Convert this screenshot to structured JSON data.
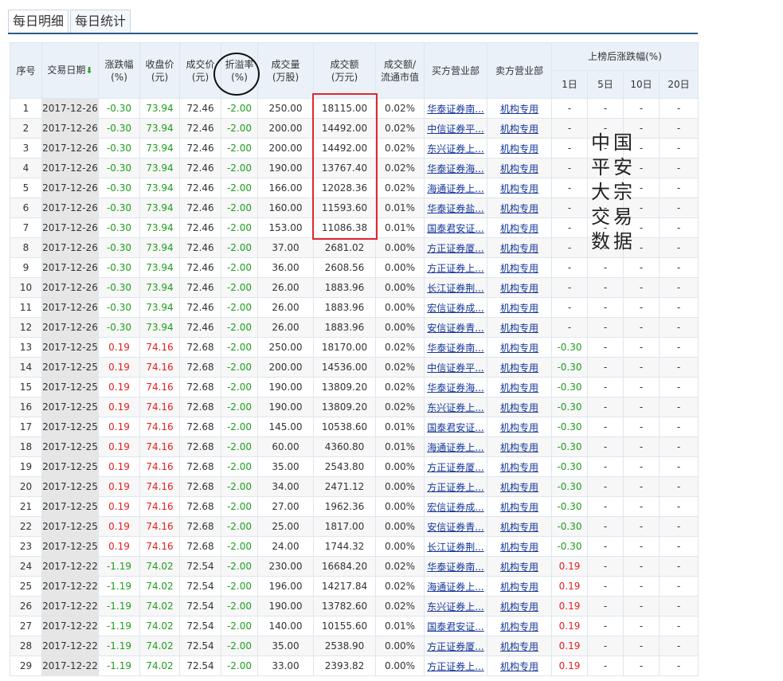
{
  "tabs": [
    "每日明细",
    "每日统计"
  ],
  "header": {
    "seq": "序号",
    "date": "交易日期",
    "date_sort_icon": "arrow-down-icon",
    "change_line1": "涨跌幅",
    "change_line2": "(%)",
    "close_line1": "收盘价",
    "close_line2": "(元)",
    "price_line1": "成交价",
    "price_line2": "(元)",
    "discount_line1": "折溢率",
    "discount_line2": "(%)",
    "volume_line1": "成交量",
    "volume_line2": "(万股)",
    "amount_line1": "成交额",
    "amount_line2": "(万元)",
    "ratio_line1": "成交额/",
    "ratio_line2": "流通市值",
    "buyer": "买方营业部",
    "seller": "卖方营业部",
    "after_group": "上榜后涨跌幅(%)",
    "d1": "1日",
    "d5": "5日",
    "d10": "10日",
    "d20": "20日"
  },
  "rows": [
    [
      "1",
      "2017-12-26",
      "-0.30",
      "73.94",
      "72.46",
      "-2.00",
      "250.00",
      "18115.00",
      "0.02%",
      "华泰证券南...",
      "机构专用",
      "-",
      "-",
      "-",
      "-"
    ],
    [
      "2",
      "2017-12-26",
      "-0.30",
      "73.94",
      "72.46",
      "-2.00",
      "200.00",
      "14492.00",
      "0.02%",
      "中信证券平...",
      "机构专用",
      "-",
      "-",
      "-",
      "-"
    ],
    [
      "3",
      "2017-12-26",
      "-0.30",
      "73.94",
      "72.46",
      "-2.00",
      "200.00",
      "14492.00",
      "0.02%",
      "东兴证券上...",
      "机构专用",
      "-",
      "-",
      "-",
      "-"
    ],
    [
      "4",
      "2017-12-26",
      "-0.30",
      "73.94",
      "72.46",
      "-2.00",
      "190.00",
      "13767.40",
      "0.02%",
      "华泰证券海...",
      "机构专用",
      "-",
      "-",
      "-",
      "-"
    ],
    [
      "5",
      "2017-12-26",
      "-0.30",
      "73.94",
      "72.46",
      "-2.00",
      "166.00",
      "12028.36",
      "0.02%",
      "海通证券上...",
      "机构专用",
      "-",
      "-",
      "-",
      "-"
    ],
    [
      "6",
      "2017-12-26",
      "-0.30",
      "73.94",
      "72.46",
      "-2.00",
      "160.00",
      "11593.60",
      "0.01%",
      "华泰证券盐...",
      "机构专用",
      "-",
      "-",
      "-",
      "-"
    ],
    [
      "7",
      "2017-12-26",
      "-0.30",
      "73.94",
      "72.46",
      "-2.00",
      "153.00",
      "11086.38",
      "0.01%",
      "国泰君安证...",
      "机构专用",
      "-",
      "-",
      "-",
      "-"
    ],
    [
      "8",
      "2017-12-26",
      "-0.30",
      "73.94",
      "72.46",
      "-2.00",
      "37.00",
      "2681.02",
      "0.00%",
      "方正证券厦...",
      "机构专用",
      "-",
      "-",
      "-",
      "-"
    ],
    [
      "9",
      "2017-12-26",
      "-0.30",
      "73.94",
      "72.46",
      "-2.00",
      "36.00",
      "2608.56",
      "0.00%",
      "方正证券上...",
      "机构专用",
      "-",
      "-",
      "-",
      "-"
    ],
    [
      "10",
      "2017-12-26",
      "-0.30",
      "73.94",
      "72.46",
      "-2.00",
      "26.00",
      "1883.96",
      "0.00%",
      "长江证券荆...",
      "机构专用",
      "-",
      "-",
      "-",
      "-"
    ],
    [
      "11",
      "2017-12-26",
      "-0.30",
      "73.94",
      "72.46",
      "-2.00",
      "26.00",
      "1883.96",
      "0.00%",
      "宏信证券成...",
      "机构专用",
      "-",
      "-",
      "-",
      "-"
    ],
    [
      "12",
      "2017-12-26",
      "-0.30",
      "73.94",
      "72.46",
      "-2.00",
      "26.00",
      "1883.96",
      "0.00%",
      "安信证券青...",
      "机构专用",
      "-",
      "-",
      "-",
      "-"
    ],
    [
      "13",
      "2017-12-25",
      "0.19",
      "74.16",
      "72.68",
      "-2.00",
      "250.00",
      "18170.00",
      "0.02%",
      "华泰证券南...",
      "机构专用",
      "-0.30",
      "-",
      "-",
      "-"
    ],
    [
      "14",
      "2017-12-25",
      "0.19",
      "74.16",
      "72.68",
      "-2.00",
      "200.00",
      "14536.00",
      "0.02%",
      "中信证券平...",
      "机构专用",
      "-0.30",
      "-",
      "-",
      "-"
    ],
    [
      "15",
      "2017-12-25",
      "0.19",
      "74.16",
      "72.68",
      "-2.00",
      "190.00",
      "13809.20",
      "0.02%",
      "华泰证券海...",
      "机构专用",
      "-0.30",
      "-",
      "-",
      "-"
    ],
    [
      "16",
      "2017-12-25",
      "0.19",
      "74.16",
      "72.68",
      "-2.00",
      "190.00",
      "13809.20",
      "0.02%",
      "东兴证券上...",
      "机构专用",
      "-0.30",
      "-",
      "-",
      "-"
    ],
    [
      "17",
      "2017-12-25",
      "0.19",
      "74.16",
      "72.68",
      "-2.00",
      "145.00",
      "10538.60",
      "0.01%",
      "国泰君安证...",
      "机构专用",
      "-0.30",
      "-",
      "-",
      "-"
    ],
    [
      "18",
      "2017-12-25",
      "0.19",
      "74.16",
      "72.68",
      "-2.00",
      "60.00",
      "4360.80",
      "0.01%",
      "海通证券上...",
      "机构专用",
      "-0.30",
      "-",
      "-",
      "-"
    ],
    [
      "19",
      "2017-12-25",
      "0.19",
      "74.16",
      "72.68",
      "-2.00",
      "35.00",
      "2543.80",
      "0.00%",
      "方正证券厦...",
      "机构专用",
      "-0.30",
      "-",
      "-",
      "-"
    ],
    [
      "20",
      "2017-12-25",
      "0.19",
      "74.16",
      "72.68",
      "-2.00",
      "34.00",
      "2471.12",
      "0.00%",
      "方正证券上...",
      "机构专用",
      "-0.30",
      "-",
      "-",
      "-"
    ],
    [
      "21",
      "2017-12-25",
      "0.19",
      "74.16",
      "72.68",
      "-2.00",
      "27.00",
      "1962.36",
      "0.00%",
      "宏信证券成...",
      "机构专用",
      "-0.30",
      "-",
      "-",
      "-"
    ],
    [
      "22",
      "2017-12-25",
      "0.19",
      "74.16",
      "72.68",
      "-2.00",
      "25.00",
      "1817.00",
      "0.00%",
      "安信证券青...",
      "机构专用",
      "-0.30",
      "-",
      "-",
      "-"
    ],
    [
      "23",
      "2017-12-25",
      "0.19",
      "74.16",
      "72.68",
      "-2.00",
      "24.00",
      "1744.32",
      "0.00%",
      "长江证券荆...",
      "机构专用",
      "-0.30",
      "-",
      "-",
      "-"
    ],
    [
      "24",
      "2017-12-22",
      "-1.19",
      "74.02",
      "72.54",
      "-2.00",
      "230.00",
      "16684.20",
      "0.02%",
      "华泰证券南...",
      "机构专用",
      "0.19",
      "-",
      "-",
      "-"
    ],
    [
      "25",
      "2017-12-22",
      "-1.19",
      "74.02",
      "72.54",
      "-2.00",
      "196.00",
      "14217.84",
      "0.02%",
      "海通证券上...",
      "机构专用",
      "0.19",
      "-",
      "-",
      "-"
    ],
    [
      "26",
      "2017-12-22",
      "-1.19",
      "74.02",
      "72.54",
      "-2.00",
      "190.00",
      "13782.60",
      "0.02%",
      "东兴证券上...",
      "机构专用",
      "0.19",
      "-",
      "-",
      "-"
    ],
    [
      "27",
      "2017-12-22",
      "-1.19",
      "74.02",
      "72.54",
      "-2.00",
      "140.00",
      "10155.60",
      "0.01%",
      "国泰君安证...",
      "机构专用",
      "0.19",
      "-",
      "-",
      "-"
    ],
    [
      "28",
      "2017-12-22",
      "-1.19",
      "74.02",
      "72.54",
      "-2.00",
      "35.00",
      "2538.90",
      "0.00%",
      "方正证券厦...",
      "机构专用",
      "0.19",
      "-",
      "-",
      "-"
    ],
    [
      "29",
      "2017-12-22",
      "-1.19",
      "74.02",
      "72.54",
      "-2.00",
      "33.00",
      "2393.82",
      "0.00%",
      "方正证券上...",
      "机构专用",
      "0.19",
      "-",
      "-",
      "-"
    ]
  ],
  "note_lines": [
    "中国",
    "平安",
    "大宗",
    "交易",
    "数据"
  ],
  "colors": {
    "up": "#e41e1e",
    "down": "#1e9e1e",
    "link": "#15379a",
    "annotation_box": "#e0282e",
    "tab_line": "#2a5a8f"
  }
}
